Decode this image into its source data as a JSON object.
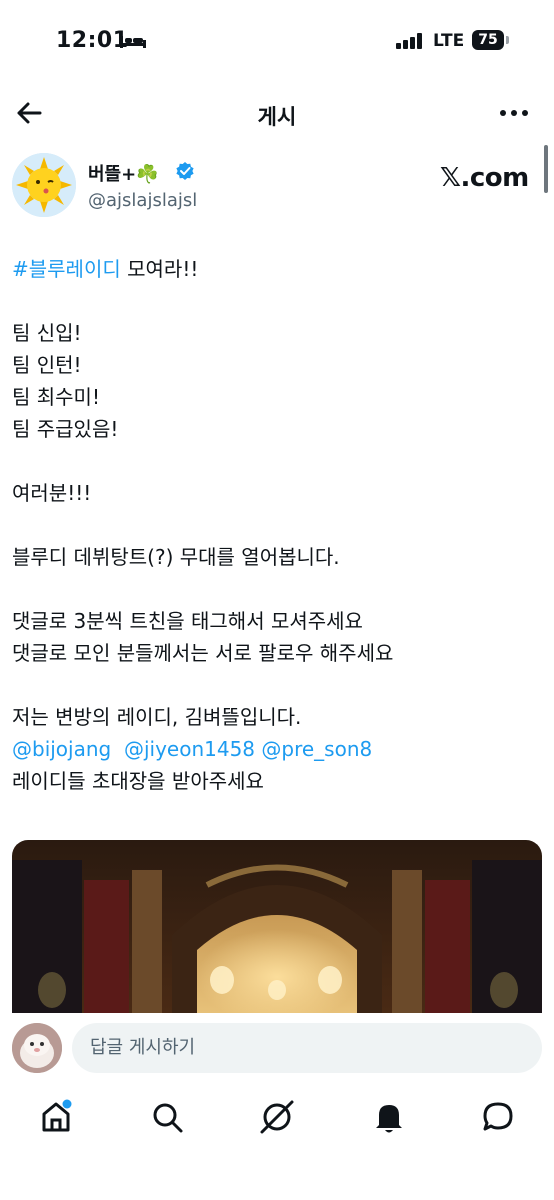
{
  "status_bar": {
    "time": "12:01",
    "network": "LTE",
    "battery": "75"
  },
  "header": {
    "title": "게시"
  },
  "author": {
    "name": "버뜰+☘️",
    "handle": "@ajslajslajsl",
    "source": "𝕏.com"
  },
  "tweet": {
    "hashtag": "#블루레이디",
    "line1_rest": " 모여라!!",
    "line2": "팀 신입!",
    "line3": "팀 인턴!",
    "line4": "팀 최수미!",
    "line5": "팀 주급있음!",
    "line6": "여러분!!!",
    "line7": "블루디 데뷔탕트(?) 무대를 열어봅니다.",
    "line8": "댓글로 3분씩 트친을 태그해서 모셔주세요",
    "line9": "댓글로 모인 분들께서는 서로 팔로우 해주세요",
    "line10": "저는 변방의 레이디, 김벼뜰입니다.",
    "mentions": [
      "@bijojang",
      "@jiyeon1458",
      "@pre_son8"
    ],
    "line12": "레이디들 초대장을 받아주세요"
  },
  "reply": {
    "placeholder": "답글 게시하기"
  },
  "nav": {
    "items": [
      "home-icon",
      "search-icon",
      "grok-icon",
      "notifications-icon",
      "messages-icon"
    ]
  },
  "colors": {
    "accent": "#1d9bf0",
    "text": "#0f1419",
    "muted": "#536471",
    "reply_bg": "#eff3f4"
  }
}
